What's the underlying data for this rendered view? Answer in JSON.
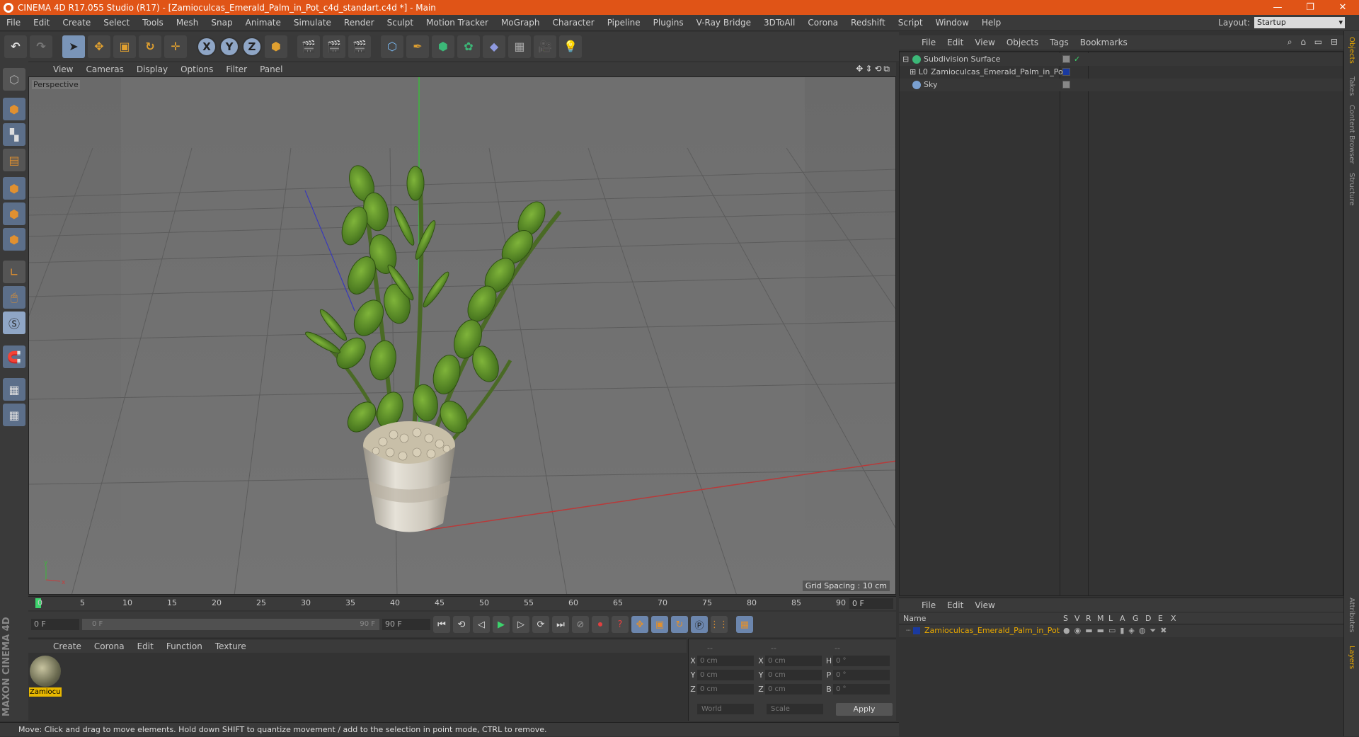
{
  "window": {
    "title": "CINEMA 4D R17.055 Studio (R17) - [Zamioculcas_Emerald_Palm_in_Pot_c4d_standart.c4d *] - Main",
    "controls": [
      "—",
      "❐",
      "✕"
    ]
  },
  "menubar": {
    "items": [
      "File",
      "Edit",
      "Create",
      "Select",
      "Tools",
      "Mesh",
      "Snap",
      "Animate",
      "Simulate",
      "Render",
      "Sculpt",
      "Motion Tracker",
      "MoGraph",
      "Character",
      "Pipeline",
      "Plugins",
      "V-Ray Bridge",
      "3DToAll",
      "Corona",
      "Redshift",
      "Script",
      "Window",
      "Help"
    ],
    "layout_label": "Layout:",
    "layout_value": "Startup"
  },
  "toolbar": {
    "xyz": [
      "X",
      "Y",
      "Z"
    ]
  },
  "viewport": {
    "menu": [
      "View",
      "Cameras",
      "Display",
      "Options",
      "Filter",
      "Panel"
    ],
    "label": "Perspective",
    "grid_spacing": "Grid Spacing : 10 cm",
    "nav_icons": "✥⇕⟲⧉"
  },
  "timeline": {
    "ticks": [
      "0",
      "5",
      "10",
      "15",
      "20",
      "25",
      "30",
      "35",
      "40",
      "45",
      "50",
      "55",
      "60",
      "65",
      "70",
      "75",
      "80",
      "85",
      "90"
    ],
    "frame_field": "0 F",
    "start_field": "0 F",
    "range_start": "0 F",
    "range_end": "90 F",
    "end_field": "90 F"
  },
  "materials": {
    "menu": [
      "Create",
      "Corona",
      "Edit",
      "Function",
      "Texture"
    ],
    "item_name": "Zamiocu"
  },
  "coordinates": {
    "header": [
      "--",
      "--",
      "--"
    ],
    "rows": [
      {
        "a": "X",
        "av": "0 cm",
        "b": "X",
        "bv": "0 cm",
        "c": "H",
        "cv": "0 °"
      },
      {
        "a": "Y",
        "av": "0 cm",
        "b": "Y",
        "bv": "0 cm",
        "c": "P",
        "cv": "0 °"
      },
      {
        "a": "Z",
        "av": "0 cm",
        "b": "Z",
        "bv": "0 cm",
        "c": "B",
        "cv": "0 °"
      }
    ],
    "world": "World",
    "scale": "Scale",
    "apply": "Apply"
  },
  "status": "Move: Click and drag to move elements. Hold down SHIFT to quantize movement / add to the selection in point mode, CTRL to remove.",
  "brand": "MAXON CINEMA 4D",
  "object_manager": {
    "menu": [
      "File",
      "Edit",
      "View",
      "Objects",
      "Tags",
      "Bookmarks"
    ],
    "tools": "⌕ ⌂ ▭ ⊟",
    "objects": [
      {
        "name": "Subdivision Surface",
        "prefix": "⊟",
        "color": "#3cb878"
      },
      {
        "name": "Zamioculcas_Emerald_Palm_in_Pot",
        "prefix": "⊞ L0",
        "color": "#7aa0d0"
      },
      {
        "name": "Sky",
        "prefix": "",
        "color": "#7aa0d0"
      }
    ]
  },
  "layer_manager": {
    "menu": [
      "File",
      "Edit",
      "View"
    ],
    "columns": [
      "Name",
      "S",
      "V",
      "R",
      "M",
      "L",
      "A",
      "G",
      "D",
      "E",
      "X"
    ],
    "layer_name": "Zamioculcas_Emerald_Palm_in_Pot"
  },
  "right_tabs": [
    "Objects",
    "Takes",
    "Content Browser",
    "Structure"
  ],
  "right_tabs_bottom": [
    "Attributes",
    "Layers"
  ],
  "colors": {
    "title": "#e05417",
    "accent": "#e8a800",
    "viewport": "#6e6e6e"
  }
}
